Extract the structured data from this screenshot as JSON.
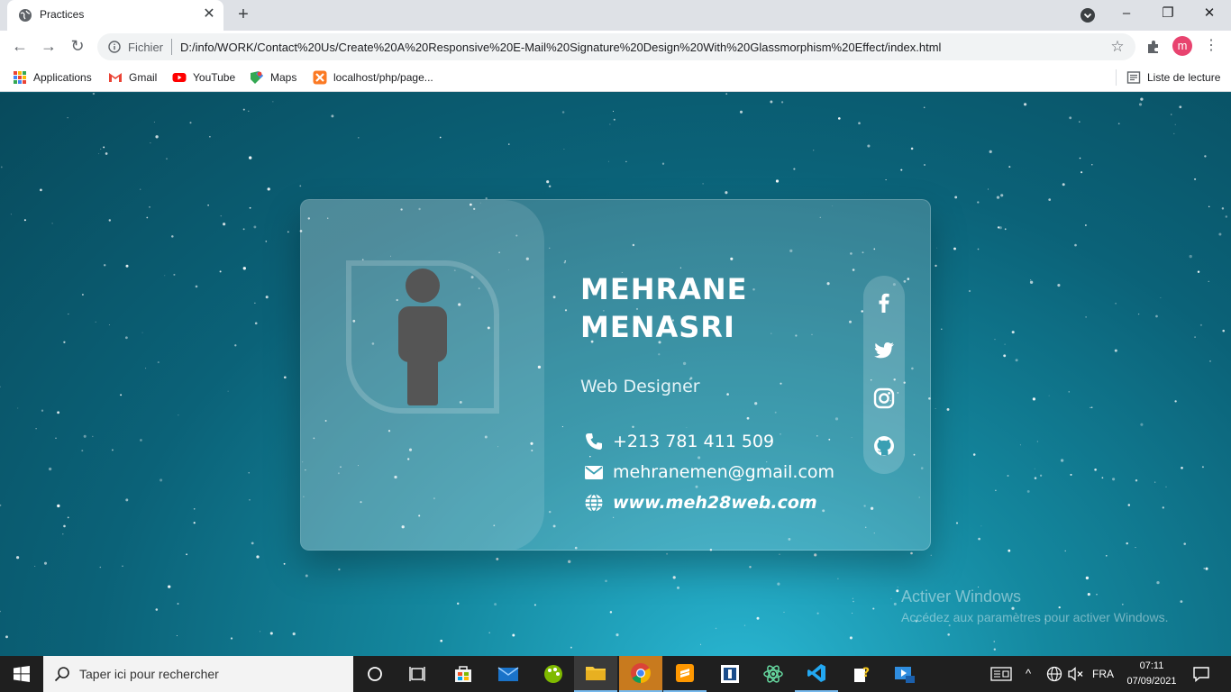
{
  "browser": {
    "tab": {
      "title": "Practices",
      "close_glyph": "✕"
    },
    "new_tab_glyph": "+",
    "window_controls": [
      "–",
      "❐",
      "✕"
    ],
    "nav": {
      "back": "←",
      "forward": "→",
      "reload": "↻"
    },
    "address": {
      "scheme_label": "Fichier",
      "url": "D:/info/WORK/Contact%20Us/Create%20A%20Responsive%20E-Mail%20Signature%20Design%20With%20Glassmorphism%20Effect/index.html"
    },
    "star_glyph": "☆",
    "profile_initial": "m",
    "menu_glyph": "⋮",
    "bookmarks": [
      {
        "label": "Applications",
        "icon": "apps-grid-icon"
      },
      {
        "label": "Gmail",
        "icon": "gmail-icon"
      },
      {
        "label": "YouTube",
        "icon": "youtube-icon"
      },
      {
        "label": "Maps",
        "icon": "maps-icon"
      },
      {
        "label": "localhost/php/page...",
        "icon": "xampp-icon"
      }
    ],
    "reading_list": "Liste de lecture"
  },
  "card": {
    "name_line1": "MEHRANE",
    "name_line2": "MENASRI",
    "role": "Web Designer",
    "phone": "+213 781 411 509",
    "email": "mehranemen@gmail.com",
    "website": "www.meh28web.com",
    "social": [
      "facebook-icon",
      "twitter-icon",
      "instagram-icon",
      "github-icon"
    ]
  },
  "watermark": {
    "title": "Activer Windows",
    "subtitle": "Accédez aux paramètres pour activer Windows."
  },
  "taskbar": {
    "search_placeholder": "Taper ici pour rechercher",
    "language": "FRA",
    "time": "07:11",
    "date": "07/09/2021"
  },
  "colors": {
    "page_bg": "#0b6278",
    "card_glass": "rgba(255,255,255,0.18)",
    "person_icon": "#555555",
    "accent_avatar": "#e8436f"
  }
}
